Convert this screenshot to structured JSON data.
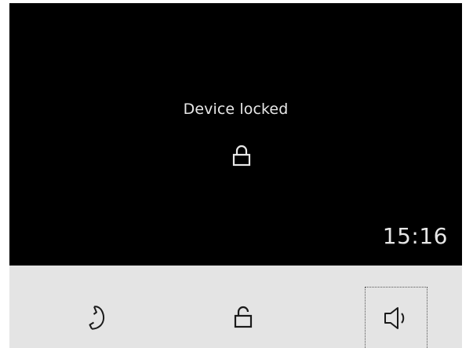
{
  "screen": {
    "status_text": "Device locked",
    "clock": "15:16",
    "lock_icon": "lock-icon"
  },
  "softkeys": [
    {
      "name": "phone-handset-icon"
    },
    {
      "name": "unlock-icon"
    },
    {
      "name": "speaker-icon",
      "focused": true
    }
  ],
  "colors": {
    "screen_bg": "#000000",
    "screen_text": "#e8e8e8",
    "softkey_bar_bg": "#e4e4e4",
    "icon_color": "#1a1a1a"
  }
}
